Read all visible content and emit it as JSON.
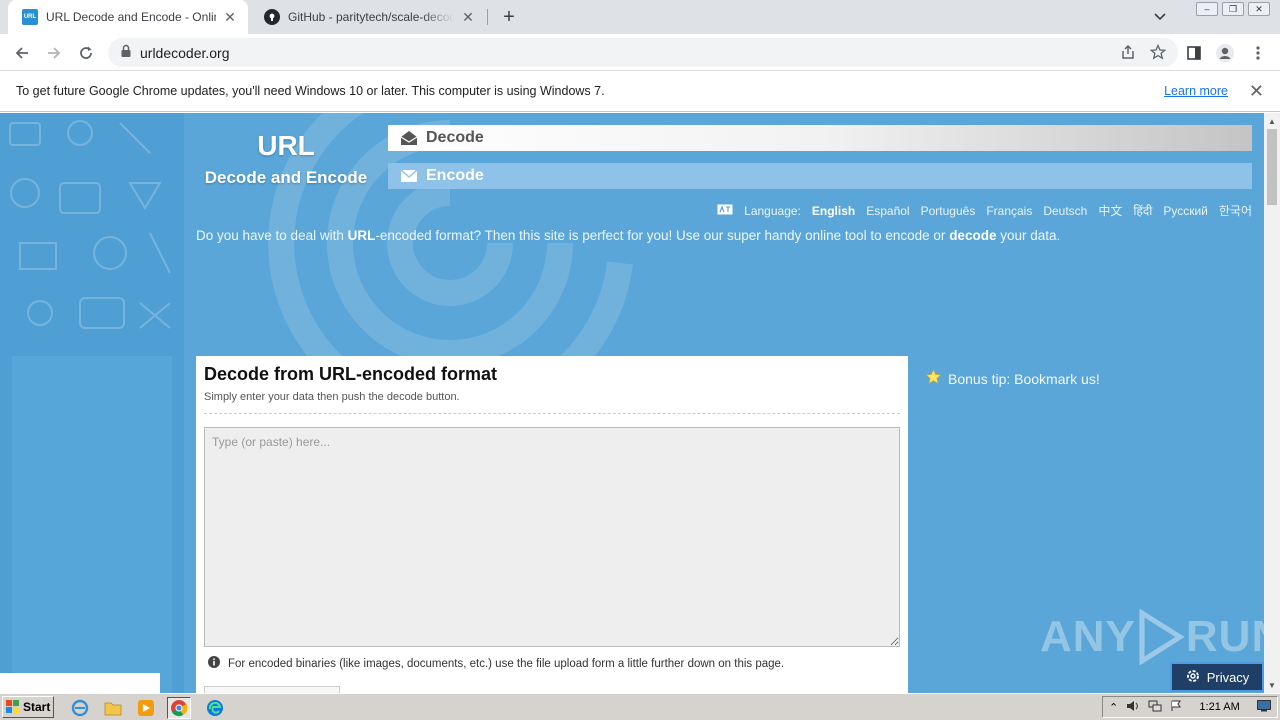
{
  "browser": {
    "tabs": [
      {
        "title": "URL Decode and Encode - Online",
        "favicon": "url-favicon",
        "active": true
      },
      {
        "title": "GitHub - paritytech/scale-decode: Decode",
        "favicon": "github-favicon",
        "active": false
      }
    ],
    "address": "urldecoder.org",
    "favicon_text": "URL"
  },
  "infobar": {
    "message": "To get future Google Chrome updates, you'll need Windows 10 or later. This computer is using Windows 7.",
    "link": "Learn more"
  },
  "site": {
    "logo_line1": "URL",
    "logo_line2": "Decode and Encode",
    "menu": {
      "decode": "Decode",
      "encode": "Encode"
    },
    "language_label": "Language:",
    "languages": [
      "English",
      "Español",
      "Português",
      "Français",
      "Deutsch",
      "中文",
      "हिंदी",
      "Русский",
      "한국어"
    ],
    "current_language": "English",
    "intro": {
      "p1": "Do you have to deal with ",
      "b1": "URL",
      "p2": "-encoded format? Then this site is perfect for you! Use our super handy online tool to encode or ",
      "b2": "decode",
      "p3": " your data."
    },
    "card": {
      "title": "Decode from URL-encoded format",
      "subtitle": "Simply enter your data then push the decode button.",
      "placeholder": "Type (or paste) here...",
      "note": "For encoded binaries (like images, documents, etc.) use the file upload form a little further down on this page."
    },
    "tip": "Bonus tip: Bookmark us!",
    "privacy": "Privacy"
  },
  "watermark": {
    "left": "ANY",
    "right": "RUN"
  },
  "taskbar": {
    "start": "Start",
    "clock": "1:21 AM"
  },
  "colors": {
    "page_bg": "#5aa6d8",
    "accent_dark": "#1f3f66"
  }
}
